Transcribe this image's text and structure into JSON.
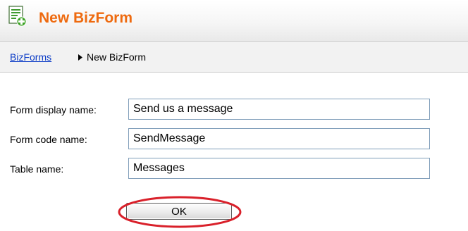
{
  "header": {
    "title": "New BizForm",
    "icon": "new-form-icon"
  },
  "breadcrumb": {
    "parent": "BizForms",
    "current": "New BizForm",
    "separator_icon": "triangle-right-icon"
  },
  "form": {
    "display_name": {
      "label": "Form display name:",
      "value": "Send us a message"
    },
    "code_name": {
      "label": "Form code name:",
      "value": "SendMessage"
    },
    "table_name": {
      "label": "Table name:",
      "value": "Messages"
    },
    "ok_label": "OK"
  },
  "colors": {
    "title": "#ee6a0f",
    "link": "#0a3bc6",
    "annotation": "#d9202a"
  }
}
